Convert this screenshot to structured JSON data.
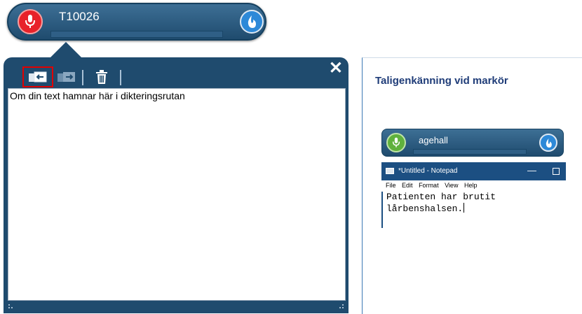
{
  "dictation_bar": {
    "username": "T10026",
    "mic_icon": "microphone-icon",
    "mic_color": "#e8222a",
    "dragon_icon": "dragon-flame-icon"
  },
  "dictation_box": {
    "text": "Om din text hamnar här i dikteringsrutan",
    "toolbar_icons": [
      "transfer-to-cursor-icon",
      "transfer-icon",
      "delete-icon"
    ],
    "close_symbol": "✕"
  },
  "slide": {
    "title": "Taligenkänning vid markör",
    "screenshot": {
      "username": "agehall",
      "mic_color": "#5fb13d",
      "notepad_title": "*Untitled - Notepad",
      "menu": [
        "File",
        "Edit",
        "Format",
        "View",
        "Help"
      ],
      "text_line1": "Patienten har brutit",
      "text_line2": "lårbenshalsen."
    }
  }
}
